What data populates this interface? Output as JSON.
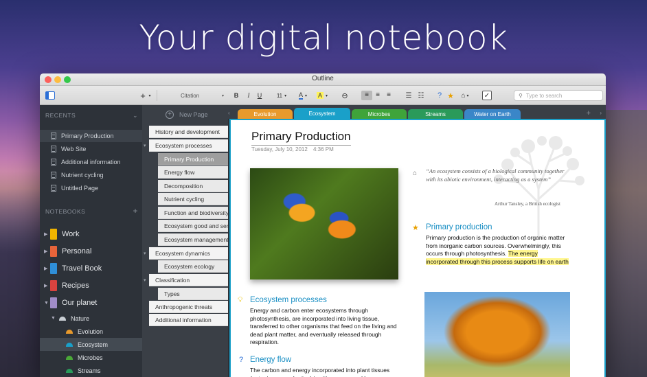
{
  "headline": "Your digital notebook",
  "window": {
    "title": "Outline"
  },
  "toolbar": {
    "add_label": "+",
    "style_value": "Citation",
    "bold": "B",
    "italic": "I",
    "underline": "U",
    "font_size": "11",
    "font_color_label": "A",
    "highlight_label": "A",
    "search_placeholder": "Type to search"
  },
  "sidebar": {
    "recents_label": "RECENTS",
    "recents": [
      {
        "label": "Primary Production",
        "selected": true
      },
      {
        "label": "Web Site"
      },
      {
        "label": "Additional information"
      },
      {
        "label": "Nutrient cycling"
      },
      {
        "label": "Untitled Page"
      }
    ],
    "notebooks_label": "NOTEBOOKS",
    "notebooks": [
      {
        "label": "Work",
        "color": "#f0b400"
      },
      {
        "label": "Personal",
        "color": "#e8643a"
      },
      {
        "label": "Travel Book",
        "color": "#2f8fd8"
      },
      {
        "label": "Recipes",
        "color": "#d8433f"
      },
      {
        "label": "Our planet",
        "color": "#a08cc8"
      }
    ],
    "section_group": "Nature",
    "sections": [
      {
        "label": "Evolution",
        "color": "#e89a2c"
      },
      {
        "label": "Ecosystem",
        "color": "#1aa0c9",
        "selected": true
      },
      {
        "label": "Microbes",
        "color": "#4aa838"
      },
      {
        "label": "Streams",
        "color": "#2a9a5a"
      }
    ]
  },
  "pages": {
    "new_page_label": "New Page",
    "items": [
      {
        "label": "History and development",
        "level": 0
      },
      {
        "label": "Ecosystem processes",
        "level": 0,
        "expanded": true
      },
      {
        "label": "Primary Production",
        "level": 1,
        "selected": true
      },
      {
        "label": "Energy flow",
        "level": 1
      },
      {
        "label": "Decomposition",
        "level": 1
      },
      {
        "label": "Nutrient cycling",
        "level": 1
      },
      {
        "label": "Function and biodiversity",
        "level": 1
      },
      {
        "label": "Ecosystem good and services",
        "level": 1
      },
      {
        "label": "Ecosystem management",
        "level": 1
      },
      {
        "label": "Ecosystem dynamics",
        "level": 0,
        "expanded": true
      },
      {
        "label": "Ecosystem ecology",
        "level": 1
      },
      {
        "label": "Classification",
        "level": 0,
        "expanded": true
      },
      {
        "label": "Types",
        "level": 1
      },
      {
        "label": "Anthropogenic threats",
        "level": 0
      },
      {
        "label": "Additional information",
        "level": 0
      }
    ]
  },
  "tabs": [
    {
      "label": "Evolution",
      "color": "#e89a2c"
    },
    {
      "label": "Ecosystem",
      "color": "#1aa0c9",
      "active": true
    },
    {
      "label": "Microbes",
      "color": "#3fa43a"
    },
    {
      "label": "Streams",
      "color": "#2a9a5a"
    },
    {
      "label": "Water on Earth",
      "color": "#3a86c8"
    }
  ],
  "page": {
    "title": "Primary Production",
    "date": "Tuesday, July 10, 2012",
    "time": "4:36 PM",
    "quote": "“An ecosystem consists of a biological community together with its abiotic environment, interacting as a system”",
    "quote_author": "Arthur Tansley, a British ecologist",
    "primary_heading": "Primary production",
    "primary_text": "Primary production is the production of organic matter from inorganic carbon sources. Overwhelmingly, this occurs through photosynthesis.",
    "primary_highlight": "The energy incorporated through this process supports life on earth",
    "eco_heading": "Ecosystem processes",
    "eco_text": "Energy and carbon enter ecosystems through photosynthesis, are incorporated into living tissue, transferred to other organisms that feed on the living and dead plant matter, and eventually released through respiration.",
    "energy_heading": "Energy flow",
    "energy_text": "The carbon and energy incorporated into plant tissues (net primary production) is either consumed by"
  }
}
